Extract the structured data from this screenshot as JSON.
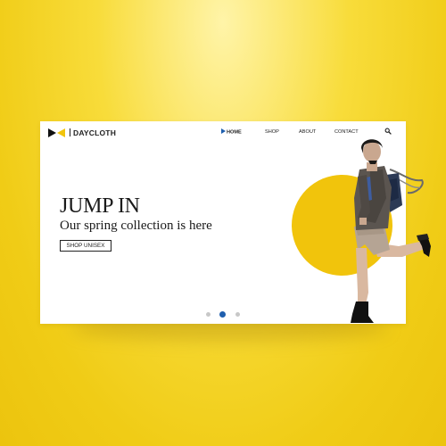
{
  "brand": {
    "name": "DAYCLOTH",
    "logo_colors": [
      "#111111",
      "#f1c40c"
    ]
  },
  "nav": {
    "items": [
      {
        "label": "HOME",
        "active": true
      },
      {
        "label": "SHOP",
        "active": false
      },
      {
        "label": "ABOUT",
        "active": false
      },
      {
        "label": "CONTACT",
        "active": false
      }
    ],
    "search_icon": "search-icon"
  },
  "hero": {
    "title": "JUMP IN",
    "subtitle": "Our spring collection is here",
    "cta_label": "SHOP UNISEX"
  },
  "carousel": {
    "slides": 3,
    "active_index": 1
  },
  "colors": {
    "accent": "#1f5fae",
    "brand_yellow": "#f1c40c",
    "background_yellow": "#f5d324"
  }
}
